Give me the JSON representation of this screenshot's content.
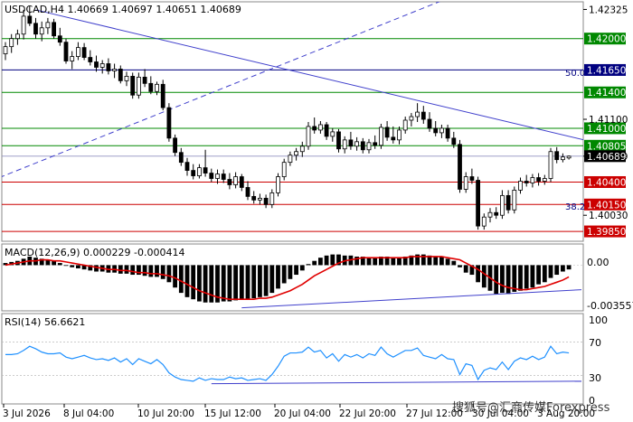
{
  "chart_data": [
    {
      "type": "candlestick",
      "title": "USDCAD,H4  1.40669 1.40697 1.40651 1.40689",
      "symbol": "USDCAD",
      "timeframe": "H4",
      "ohlc_last": {
        "open": 1.40669,
        "high": 1.40697,
        "low": 1.40651,
        "close": 1.40689
      },
      "ylim": [
        1.3975,
        1.424
      ],
      "y_tick_labels": [
        "1.42325",
        "1.41100",
        "1.40689",
        "1.40030"
      ],
      "x_tick_labels": [
        "3 Jul 2026",
        "8 Jul 04:00",
        "10 Jul 20:00",
        "15 Jul 12:00",
        "20 Jul 04:00",
        "22 Jul 20:00",
        "27 Jul 12:00",
        "30 Jul 04:00",
        "3 Aug 20:00"
      ],
      "levels": [
        {
          "label": "1.42000",
          "value": 1.42,
          "color": "#008800",
          "style": "solid"
        },
        {
          "label": "1.41650",
          "value": 1.4165,
          "color": "#000080",
          "style": "solid"
        },
        {
          "label": "1.41400",
          "value": 1.414,
          "color": "#008800",
          "style": "solid"
        },
        {
          "label": "1.41000",
          "value": 1.41,
          "color": "#008800",
          "style": "solid"
        },
        {
          "label": "1.40805",
          "value": 1.40805,
          "color": "#008800",
          "style": "solid"
        },
        {
          "label": "1.40400",
          "value": 1.404,
          "color": "#cc0000",
          "style": "solid"
        },
        {
          "label": "1.40150",
          "value": 1.4015,
          "color": "#cc0000",
          "style": "solid"
        },
        {
          "label": "1.39850",
          "value": 1.3985,
          "color": "#cc0000",
          "style": "solid"
        }
      ],
      "fib_labels": [
        {
          "label": "50.0",
          "value": 1.4165
        },
        {
          "label": "38.2",
          "value": 1.4022
        }
      ],
      "current_price_label": "1.40689",
      "candles": [
        {
          "t": 0,
          "o": 1.4183,
          "h": 1.4196,
          "l": 1.4176,
          "c": 1.4191
        },
        {
          "t": 1,
          "o": 1.4191,
          "h": 1.4205,
          "l": 1.4184,
          "c": 1.42
        },
        {
          "t": 2,
          "o": 1.42,
          "h": 1.421,
          "l": 1.4193,
          "c": 1.4205
        },
        {
          "t": 3,
          "o": 1.4205,
          "h": 1.4232,
          "l": 1.4199,
          "c": 1.4225
        },
        {
          "t": 4,
          "o": 1.4225,
          "h": 1.4236,
          "l": 1.4214,
          "c": 1.4217
        },
        {
          "t": 5,
          "o": 1.4217,
          "h": 1.4223,
          "l": 1.42,
          "c": 1.4205
        },
        {
          "t": 6,
          "o": 1.4205,
          "h": 1.4219,
          "l": 1.4197,
          "c": 1.4212
        },
        {
          "t": 7,
          "o": 1.4212,
          "h": 1.4223,
          "l": 1.4205,
          "c": 1.4218
        },
        {
          "t": 8,
          "o": 1.4218,
          "h": 1.4222,
          "l": 1.42,
          "c": 1.4203
        },
        {
          "t": 9,
          "o": 1.4203,
          "h": 1.4212,
          "l": 1.4192,
          "c": 1.4196
        },
        {
          "t": 10,
          "o": 1.4196,
          "h": 1.42,
          "l": 1.4172,
          "c": 1.4175
        },
        {
          "t": 11,
          "o": 1.4175,
          "h": 1.4186,
          "l": 1.4166,
          "c": 1.418
        },
        {
          "t": 12,
          "o": 1.418,
          "h": 1.4196,
          "l": 1.4176,
          "c": 1.419
        },
        {
          "t": 13,
          "o": 1.419,
          "h": 1.4195,
          "l": 1.4176,
          "c": 1.4179
        },
        {
          "t": 14,
          "o": 1.4179,
          "h": 1.4187,
          "l": 1.417,
          "c": 1.4174
        },
        {
          "t": 15,
          "o": 1.4174,
          "h": 1.4181,
          "l": 1.4163,
          "c": 1.4168
        },
        {
          "t": 16,
          "o": 1.4168,
          "h": 1.4176,
          "l": 1.4161,
          "c": 1.4172
        },
        {
          "t": 17,
          "o": 1.4172,
          "h": 1.4178,
          "l": 1.416,
          "c": 1.4164
        },
        {
          "t": 18,
          "o": 1.4164,
          "h": 1.4172,
          "l": 1.4156,
          "c": 1.4166
        },
        {
          "t": 19,
          "o": 1.4166,
          "h": 1.417,
          "l": 1.415,
          "c": 1.4153
        },
        {
          "t": 20,
          "o": 1.4153,
          "h": 1.4163,
          "l": 1.4147,
          "c": 1.4158
        },
        {
          "t": 21,
          "o": 1.4158,
          "h": 1.4162,
          "l": 1.4133,
          "c": 1.4137
        },
        {
          "t": 22,
          "o": 1.4137,
          "h": 1.4162,
          "l": 1.4133,
          "c": 1.4157
        },
        {
          "t": 23,
          "o": 1.4157,
          "h": 1.4166,
          "l": 1.4146,
          "c": 1.415
        },
        {
          "t": 24,
          "o": 1.415,
          "h": 1.4158,
          "l": 1.4138,
          "c": 1.4141
        },
        {
          "t": 25,
          "o": 1.4141,
          "h": 1.4152,
          "l": 1.4137,
          "c": 1.4149
        },
        {
          "t": 26,
          "o": 1.4149,
          "h": 1.4154,
          "l": 1.412,
          "c": 1.4123
        },
        {
          "t": 27,
          "o": 1.4123,
          "h": 1.4128,
          "l": 1.4085,
          "c": 1.4089
        },
        {
          "t": 28,
          "o": 1.4089,
          "h": 1.4093,
          "l": 1.4069,
          "c": 1.4073
        },
        {
          "t": 29,
          "o": 1.4073,
          "h": 1.4078,
          "l": 1.4058,
          "c": 1.4062
        },
        {
          "t": 30,
          "o": 1.4062,
          "h": 1.4067,
          "l": 1.4047,
          "c": 1.4053
        },
        {
          "t": 31,
          "o": 1.4053,
          "h": 1.406,
          "l": 1.4043,
          "c": 1.4047
        },
        {
          "t": 32,
          "o": 1.4047,
          "h": 1.406,
          "l": 1.4044,
          "c": 1.4056
        },
        {
          "t": 33,
          "o": 1.4056,
          "h": 1.4076,
          "l": 1.4046,
          "c": 1.405
        },
        {
          "t": 34,
          "o": 1.405,
          "h": 1.4055,
          "l": 1.404,
          "c": 1.4044
        },
        {
          "t": 35,
          "o": 1.4044,
          "h": 1.4054,
          "l": 1.4038,
          "c": 1.4049
        },
        {
          "t": 36,
          "o": 1.4049,
          "h": 1.4054,
          "l": 1.4039,
          "c": 1.4043
        },
        {
          "t": 37,
          "o": 1.4043,
          "h": 1.405,
          "l": 1.4032,
          "c": 1.4037
        },
        {
          "t": 38,
          "o": 1.4037,
          "h": 1.4051,
          "l": 1.4033,
          "c": 1.4046
        },
        {
          "t": 39,
          "o": 1.4046,
          "h": 1.4049,
          "l": 1.403,
          "c": 1.4034
        },
        {
          "t": 40,
          "o": 1.4034,
          "h": 1.4041,
          "l": 1.402,
          "c": 1.4024
        },
        {
          "t": 41,
          "o": 1.4024,
          "h": 1.403,
          "l": 1.4016,
          "c": 1.402
        },
        {
          "t": 42,
          "o": 1.402,
          "h": 1.4027,
          "l": 1.4015,
          "c": 1.4022
        },
        {
          "t": 43,
          "o": 1.4022,
          "h": 1.4026,
          "l": 1.4011,
          "c": 1.4015
        },
        {
          "t": 44,
          "o": 1.4015,
          "h": 1.4032,
          "l": 1.4011,
          "c": 1.4028
        },
        {
          "t": 45,
          "o": 1.4028,
          "h": 1.405,
          "l": 1.4024,
          "c": 1.4046
        },
        {
          "t": 46,
          "o": 1.4046,
          "h": 1.4066,
          "l": 1.4042,
          "c": 1.4062
        },
        {
          "t": 47,
          "o": 1.4062,
          "h": 1.4074,
          "l": 1.4058,
          "c": 1.407
        },
        {
          "t": 48,
          "o": 1.407,
          "h": 1.4078,
          "l": 1.4064,
          "c": 1.4074
        },
        {
          "t": 49,
          "o": 1.4074,
          "h": 1.4085,
          "l": 1.4068,
          "c": 1.408
        },
        {
          "t": 50,
          "o": 1.408,
          "h": 1.4107,
          "l": 1.4076,
          "c": 1.4102
        },
        {
          "t": 51,
          "o": 1.4102,
          "h": 1.4112,
          "l": 1.4094,
          "c": 1.4098
        },
        {
          "t": 52,
          "o": 1.4098,
          "h": 1.4108,
          "l": 1.4094,
          "c": 1.4104
        },
        {
          "t": 53,
          "o": 1.4104,
          "h": 1.4107,
          "l": 1.4087,
          "c": 1.4091
        },
        {
          "t": 54,
          "o": 1.4091,
          "h": 1.41,
          "l": 1.4085,
          "c": 1.4096
        },
        {
          "t": 55,
          "o": 1.4096,
          "h": 1.4099,
          "l": 1.4073,
          "c": 1.4077
        },
        {
          "t": 56,
          "o": 1.4077,
          "h": 1.4091,
          "l": 1.4072,
          "c": 1.4087
        },
        {
          "t": 57,
          "o": 1.4087,
          "h": 1.4096,
          "l": 1.4076,
          "c": 1.408
        },
        {
          "t": 58,
          "o": 1.408,
          "h": 1.409,
          "l": 1.4075,
          "c": 1.4085
        },
        {
          "t": 59,
          "o": 1.4085,
          "h": 1.4089,
          "l": 1.4072,
          "c": 1.4076
        },
        {
          "t": 60,
          "o": 1.4076,
          "h": 1.4088,
          "l": 1.4072,
          "c": 1.4084
        },
        {
          "t": 61,
          "o": 1.4084,
          "h": 1.4092,
          "l": 1.4077,
          "c": 1.4081
        },
        {
          "t": 62,
          "o": 1.4081,
          "h": 1.4105,
          "l": 1.4077,
          "c": 1.4101
        },
        {
          "t": 63,
          "o": 1.4101,
          "h": 1.4108,
          "l": 1.4086,
          "c": 1.409
        },
        {
          "t": 64,
          "o": 1.409,
          "h": 1.4102,
          "l": 1.4083,
          "c": 1.4087
        },
        {
          "t": 65,
          "o": 1.4087,
          "h": 1.4102,
          "l": 1.4082,
          "c": 1.4098
        },
        {
          "t": 66,
          "o": 1.4098,
          "h": 1.4113,
          "l": 1.4094,
          "c": 1.4109
        },
        {
          "t": 67,
          "o": 1.4109,
          "h": 1.4117,
          "l": 1.4102,
          "c": 1.4113
        },
        {
          "t": 68,
          "o": 1.4113,
          "h": 1.4128,
          "l": 1.4107,
          "c": 1.4118
        },
        {
          "t": 69,
          "o": 1.4118,
          "h": 1.4125,
          "l": 1.4105,
          "c": 1.411
        },
        {
          "t": 70,
          "o": 1.411,
          "h": 1.4118,
          "l": 1.4096,
          "c": 1.41
        },
        {
          "t": 71,
          "o": 1.41,
          "h": 1.4108,
          "l": 1.4091,
          "c": 1.4095
        },
        {
          "t": 72,
          "o": 1.4095,
          "h": 1.4104,
          "l": 1.4089,
          "c": 1.41
        },
        {
          "t": 73,
          "o": 1.41,
          "h": 1.4104,
          "l": 1.4085,
          "c": 1.4089
        },
        {
          "t": 74,
          "o": 1.4089,
          "h": 1.4096,
          "l": 1.4078,
          "c": 1.4082
        },
        {
          "t": 75,
          "o": 1.4082,
          "h": 1.4087,
          "l": 1.4028,
          "c": 1.4032
        },
        {
          "t": 76,
          "o": 1.4032,
          "h": 1.4051,
          "l": 1.4028,
          "c": 1.4046
        },
        {
          "t": 77,
          "o": 1.4046,
          "h": 1.4055,
          "l": 1.4038,
          "c": 1.4042
        },
        {
          "t": 78,
          "o": 1.4042,
          "h": 1.4046,
          "l": 1.3987,
          "c": 1.3991
        },
        {
          "t": 79,
          "o": 1.3991,
          "h": 1.4005,
          "l": 1.3987,
          "c": 1.4001
        },
        {
          "t": 80,
          "o": 1.4001,
          "h": 1.4011,
          "l": 1.3995,
          "c": 1.4006
        },
        {
          "t": 81,
          "o": 1.4006,
          "h": 1.4012,
          "l": 1.3999,
          "c": 1.4003
        },
        {
          "t": 82,
          "o": 1.4003,
          "h": 1.4031,
          "l": 1.3999,
          "c": 1.4025
        },
        {
          "t": 83,
          "o": 1.4025,
          "h": 1.4031,
          "l": 1.4005,
          "c": 1.4009
        },
        {
          "t": 84,
          "o": 1.4009,
          "h": 1.4035,
          "l": 1.4005,
          "c": 1.4031
        },
        {
          "t": 85,
          "o": 1.4031,
          "h": 1.4045,
          "l": 1.4027,
          "c": 1.4041
        },
        {
          "t": 86,
          "o": 1.4041,
          "h": 1.4048,
          "l": 1.4035,
          "c": 1.4039
        },
        {
          "t": 87,
          "o": 1.4039,
          "h": 1.4049,
          "l": 1.4034,
          "c": 1.4045
        },
        {
          "t": 88,
          "o": 1.4045,
          "h": 1.405,
          "l": 1.4036,
          "c": 1.4041
        },
        {
          "t": 89,
          "o": 1.4041,
          "h": 1.4048,
          "l": 1.4037,
          "c": 1.4044
        },
        {
          "t": 90,
          "o": 1.4044,
          "h": 1.4078,
          "l": 1.404,
          "c": 1.4074
        },
        {
          "t": 91,
          "o": 1.4074,
          "h": 1.4079,
          "l": 1.4061,
          "c": 1.4065
        },
        {
          "t": 92,
          "o": 1.4065,
          "h": 1.4072,
          "l": 1.4062,
          "c": 1.4068
        },
        {
          "t": 93,
          "o": 1.40669,
          "h": 1.40697,
          "l": 1.40651,
          "c": 1.40689
        }
      ],
      "trendlines": [
        {
          "style": "solid",
          "color": "#4040cc",
          "from": {
            "t": 5,
            "price": 1.4232
          },
          "to": {
            "t": 98,
            "price": 1.4083
          }
        },
        {
          "style": "dashed",
          "color": "#4040cc",
          "from": {
            "t": -1,
            "price": 1.4045
          },
          "to": {
            "t": 76,
            "price": 1.4253
          }
        }
      ]
    },
    {
      "type": "bar",
      "title": "MACD(12,26,9) 0.000229 -0.000414",
      "ylim": [
        -0.0042,
        0.0019
      ],
      "y_tick_labels": [
        "0.00",
        "-0.003557"
      ],
      "histogram": [
        0.0002,
        0.0003,
        0.0004,
        0.0006,
        0.0008,
        0.0007,
        0.0006,
        0.0005,
        0.0004,
        0.0002,
        0.0,
        -0.0002,
        -0.0003,
        -0.0004,
        -0.0005,
        -0.0006,
        -0.0006,
        -0.0007,
        -0.0007,
        -0.0008,
        -0.0008,
        -0.0009,
        -0.0009,
        -0.001,
        -0.0011,
        -0.0011,
        -0.0013,
        -0.0016,
        -0.0021,
        -0.0026,
        -0.003,
        -0.0032,
        -0.0034,
        -0.0035,
        -0.0035,
        -0.0035,
        -0.0034,
        -0.0034,
        -0.0033,
        -0.0032,
        -0.0032,
        -0.0031,
        -0.003,
        -0.0029,
        -0.0026,
        -0.0022,
        -0.0017,
        -0.0013,
        -0.0009,
        -0.0005,
        0.0001,
        0.0004,
        0.0007,
        0.0009,
        0.001,
        0.001,
        0.0009,
        0.0009,
        0.0008,
        0.0008,
        0.0007,
        0.0007,
        0.0008,
        0.0008,
        0.0007,
        0.0007,
        0.0008,
        0.0009,
        0.001,
        0.001,
        0.0009,
        0.0008,
        0.0008,
        0.0006,
        0.0004,
        -0.0002,
        -0.0007,
        -0.0009,
        -0.0016,
        -0.0021,
        -0.0024,
        -0.0027,
        -0.0026,
        -0.0027,
        -0.0025,
        -0.0024,
        -0.0022,
        -0.0021,
        -0.0018,
        -0.0016,
        -0.0012,
        -0.0009,
        -0.0006,
        -0.0004
      ],
      "signal": [
        0.0,
        0.0001,
        0.0002,
        0.0003,
        0.0004,
        0.0004,
        0.0005,
        0.0005,
        0.0004,
        0.0004,
        0.0003,
        0.0002,
        0.0001,
        0.0,
        -0.0001,
        -0.0002,
        -0.0003,
        -0.0004,
        -0.0004,
        -0.0005,
        -0.0005,
        -0.0006,
        -0.0007,
        -0.0007,
        -0.0008,
        -0.0008,
        -0.0009,
        -0.001,
        -0.0012,
        -0.0015,
        -0.0018,
        -0.0021,
        -0.0024,
        -0.0026,
        -0.0028,
        -0.003,
        -0.0031,
        -0.0032,
        -0.0032,
        -0.0032,
        -0.0032,
        -0.0032,
        -0.0031,
        -0.0031,
        -0.003,
        -0.0028,
        -0.0026,
        -0.0024,
        -0.0021,
        -0.0018,
        -0.0014,
        -0.001,
        -0.0007,
        -0.0004,
        -0.0001,
        0.0002,
        0.0004,
        0.0005,
        0.0006,
        0.0007,
        0.0007,
        0.0007,
        0.0007,
        0.0007,
        0.0007,
        0.0007,
        0.0007,
        0.0008,
        0.0008,
        0.0008,
        0.0008,
        0.0008,
        0.0008,
        0.0007,
        0.0006,
        0.0005,
        0.0002,
        -0.0001,
        -0.0004,
        -0.0008,
        -0.0012,
        -0.0016,
        -0.0019,
        -0.0021,
        -0.0022,
        -0.0023,
        -0.0023,
        -0.0022,
        -0.0021,
        -0.002,
        -0.0018,
        -0.0016,
        -0.0014,
        -0.0011
      ]
    },
    {
      "type": "line",
      "title": "RSI(14) 56.6621",
      "ylim": [
        0,
        100
      ],
      "y_tick_labels": [
        "100",
        "70",
        "30",
        "0"
      ],
      "levels": [
        70,
        30
      ],
      "values": [
        55,
        55,
        56,
        60,
        65,
        62,
        58,
        56,
        56,
        57,
        52,
        50,
        52,
        54,
        51,
        49,
        50,
        48,
        51,
        46,
        50,
        43,
        50,
        47,
        44,
        49,
        43,
        33,
        28,
        25,
        24,
        23,
        27,
        24,
        26,
        25,
        25,
        28,
        26,
        27,
        24,
        25,
        26,
        24,
        31,
        41,
        53,
        57,
        57,
        58,
        64,
        58,
        60,
        51,
        56,
        47,
        55,
        52,
        55,
        51,
        56,
        54,
        64,
        56,
        52,
        56,
        60,
        60,
        63,
        54,
        52,
        50,
        55,
        50,
        49,
        31,
        44,
        42,
        25,
        36,
        39,
        37,
        46,
        37,
        47,
        51,
        49,
        53,
        49,
        52,
        65,
        56,
        58,
        57
      ]
    }
  ],
  "watermark": "搜狐号@汇商传媒Forexpress"
}
